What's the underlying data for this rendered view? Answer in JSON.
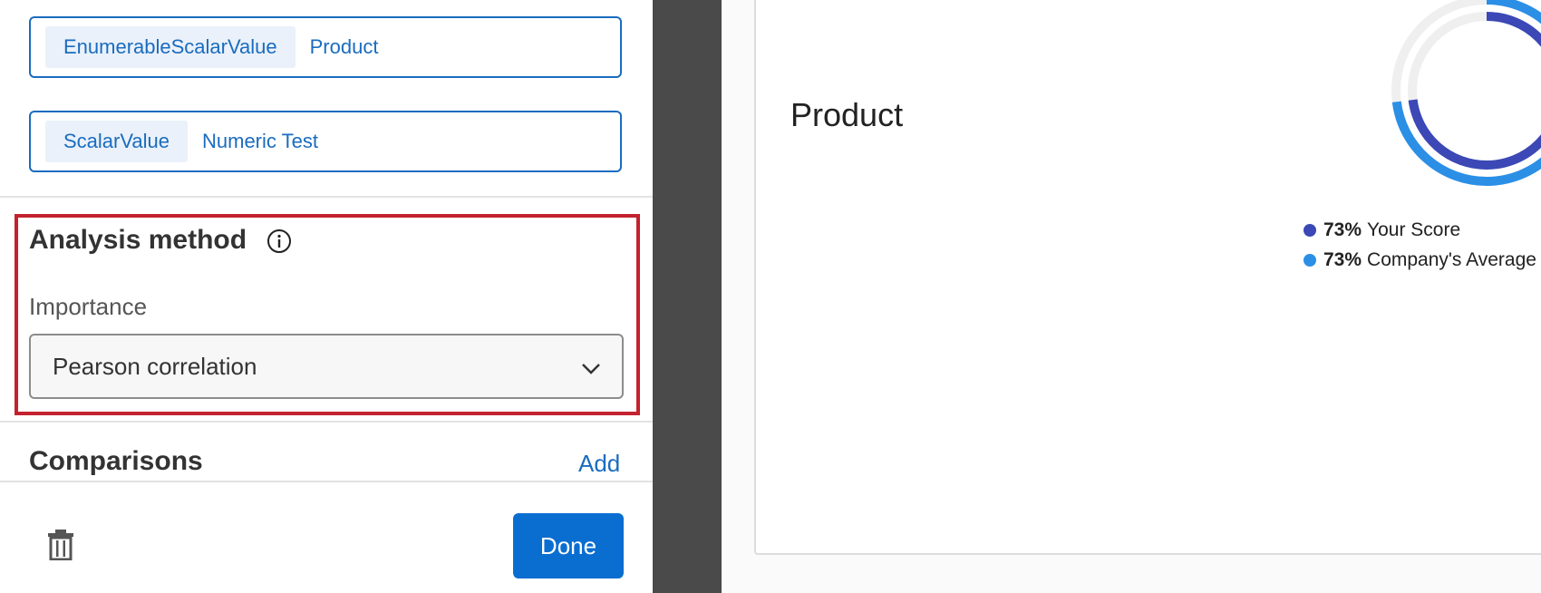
{
  "fields": [
    {
      "tag": "EnumerableScalarValue",
      "value": "Product"
    },
    {
      "tag": "ScalarValue",
      "value": "Numeric Test"
    }
  ],
  "analysis": {
    "title": "Analysis method",
    "importance_label": "Importance",
    "selected_method": "Pearson correlation"
  },
  "comparisons": {
    "title": "Comparisons",
    "add_label": "Add"
  },
  "footer": {
    "done_label": "Done"
  },
  "preview": {
    "card_title": "Product",
    "legend": [
      {
        "value": "73%",
        "label": "Your Score",
        "color": "#3b48b5"
      },
      {
        "value": "73%",
        "label": "Company's Average",
        "color": "#2b8fe6"
      }
    ],
    "ring_values": {
      "your_score": 0.73,
      "company_average": 0.73
    }
  },
  "colors": {
    "accent": "#1a6cbf",
    "highlight": "#c4222e",
    "primary_button": "#0a6ed1"
  },
  "icons": [
    "info-icon",
    "chevron-down-icon",
    "trash-icon"
  ]
}
